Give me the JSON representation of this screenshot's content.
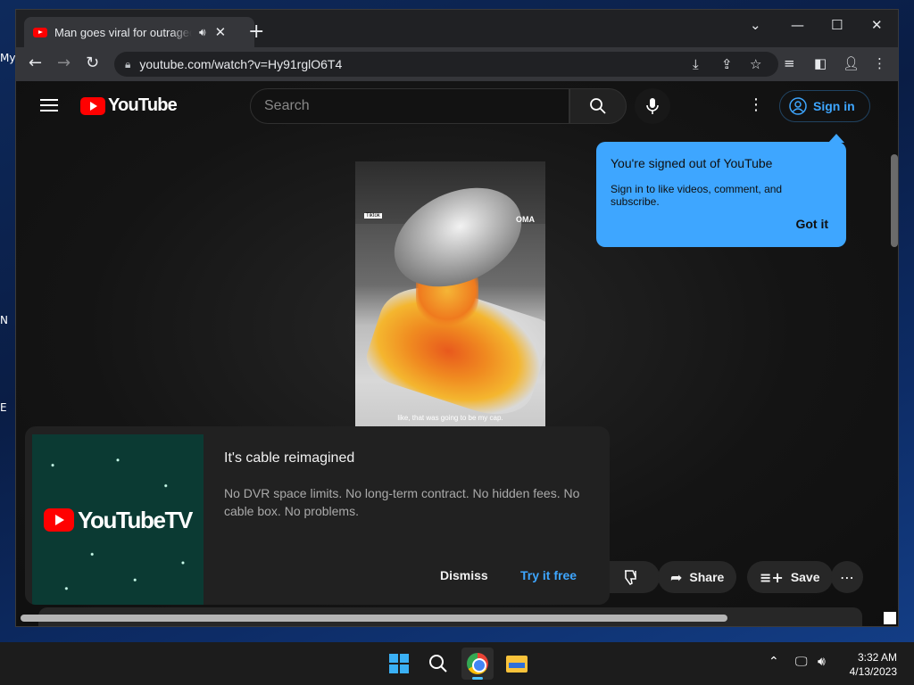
{
  "desktop": {
    "icon_labels": [
      "My",
      "N",
      "E"
    ]
  },
  "browser": {
    "tab_title": "Man goes viral for outrageous",
    "url": "youtube.com/watch?v=Hy91rglO6T4"
  },
  "youtube": {
    "logo_text": "YouTube",
    "search_placeholder": "Search",
    "signin_label": "Sign in"
  },
  "tooltip": {
    "title": "You're signed out of YouTube",
    "body": "Sign in to like videos, comment, and subscribe.",
    "button": "Got it"
  },
  "video": {
    "caption": "like, that was going to be my cap.",
    "watermark": "OMA",
    "tag": "Tiktok"
  },
  "promo": {
    "logo_text": "YouTubeTV",
    "title": "It's cable reimagined",
    "body": "No DVR space limits. No long-term contract. No hidden fees. No cable box. No problems.",
    "dismiss": "Dismiss",
    "try_label": "Try it free"
  },
  "actions": {
    "share": "Share",
    "save": "Save"
  },
  "taskbar": {
    "time": "3:32 AM",
    "date": "4/13/2023"
  },
  "colors": {
    "accent": "#3ea6ff",
    "brand_red": "#ff0000"
  }
}
